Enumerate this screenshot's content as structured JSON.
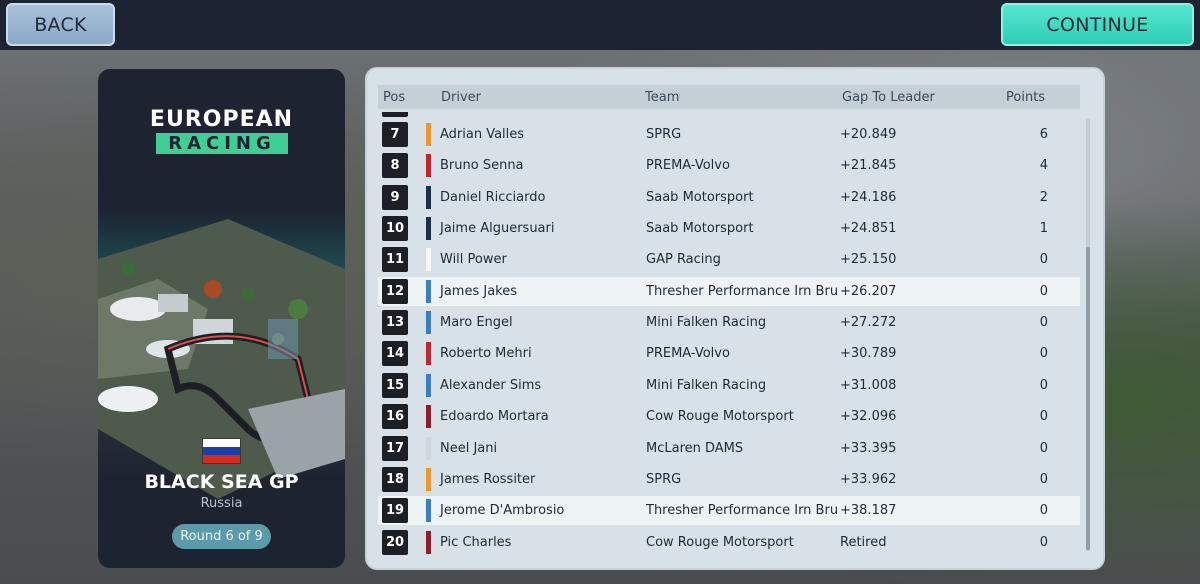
{
  "top_bar": {
    "back_label": "BACK",
    "continue_label": "CONTINUE"
  },
  "event_card": {
    "logo_line1": "EUROPEAN",
    "logo_line2": "RACING",
    "gp_name": "BLACK SEA GP",
    "country": "Russia",
    "round": "Round 6 of 9",
    "flag_colors": [
      "#ffffff",
      "#1c3fa8",
      "#d52b1e"
    ]
  },
  "results": {
    "headers": {
      "pos": "Pos",
      "driver": "Driver",
      "team": "Team",
      "gap": "Gap To Leader",
      "points": "Points"
    },
    "rows": [
      {
        "pos": "7",
        "driver": "Adrian Valles",
        "team": "SPRG",
        "gap": "+20.849",
        "points": "6",
        "team_color": "#f0962f",
        "highlight": false
      },
      {
        "pos": "8",
        "driver": "Bruno Senna",
        "team": "PREMA-Volvo",
        "gap": "+21.845",
        "points": "4",
        "team_color": "#c0262b",
        "highlight": false
      },
      {
        "pos": "9",
        "driver": "Daniel Ricciardo",
        "team": "Saab Motorsport",
        "gap": "+24.186",
        "points": "2",
        "team_color": "#1d2f4f",
        "highlight": false
      },
      {
        "pos": "10",
        "driver": "Jaime Alguersuari",
        "team": "Saab Motorsport",
        "gap": "+24.851",
        "points": "1",
        "team_color": "#1d2f4f",
        "highlight": false
      },
      {
        "pos": "11",
        "driver": "Will Power",
        "team": "GAP Racing",
        "gap": "+25.150",
        "points": "0",
        "team_color": "#f4f6f8",
        "highlight": false
      },
      {
        "pos": "12",
        "driver": "James Jakes",
        "team": "Thresher Performance Irn Bru",
        "gap": "+26.207",
        "points": "0",
        "team_color": "#3a7fc4",
        "highlight": true
      },
      {
        "pos": "13",
        "driver": "Maro Engel",
        "team": "Mini Falken Racing",
        "gap": "+27.272",
        "points": "0",
        "team_color": "#3a7fc4",
        "highlight": false
      },
      {
        "pos": "14",
        "driver": "Roberto Mehri",
        "team": "PREMA-Volvo",
        "gap": "+30.789",
        "points": "0",
        "team_color": "#c0262b",
        "highlight": false
      },
      {
        "pos": "15",
        "driver": "Alexander Sims",
        "team": "Mini Falken Racing",
        "gap": "+31.008",
        "points": "0",
        "team_color": "#3a7fc4",
        "highlight": false
      },
      {
        "pos": "16",
        "driver": "Edoardo Mortara",
        "team": "Cow Rouge Motorsport",
        "gap": "+32.096",
        "points": "0",
        "team_color": "#8f1d24",
        "highlight": false
      },
      {
        "pos": "17",
        "driver": "Neel Jani",
        "team": "McLaren DAMS",
        "gap": "+33.395",
        "points": "0",
        "team_color": "#cfd6db",
        "highlight": false
      },
      {
        "pos": "18",
        "driver": "James Rossiter",
        "team": "SPRG",
        "gap": "+33.962",
        "points": "0",
        "team_color": "#f0962f",
        "highlight": false
      },
      {
        "pos": "19",
        "driver": "Jerome D'Ambrosio",
        "team": "Thresher Performance Irn Bru",
        "gap": "+38.187",
        "points": "0",
        "team_color": "#3a7fc4",
        "highlight": true
      },
      {
        "pos": "20",
        "driver": "Pic Charles",
        "team": "Cow Rouge Motorsport",
        "gap": "Retired",
        "points": "0",
        "team_color": "#8f1d24",
        "highlight": false
      }
    ]
  }
}
